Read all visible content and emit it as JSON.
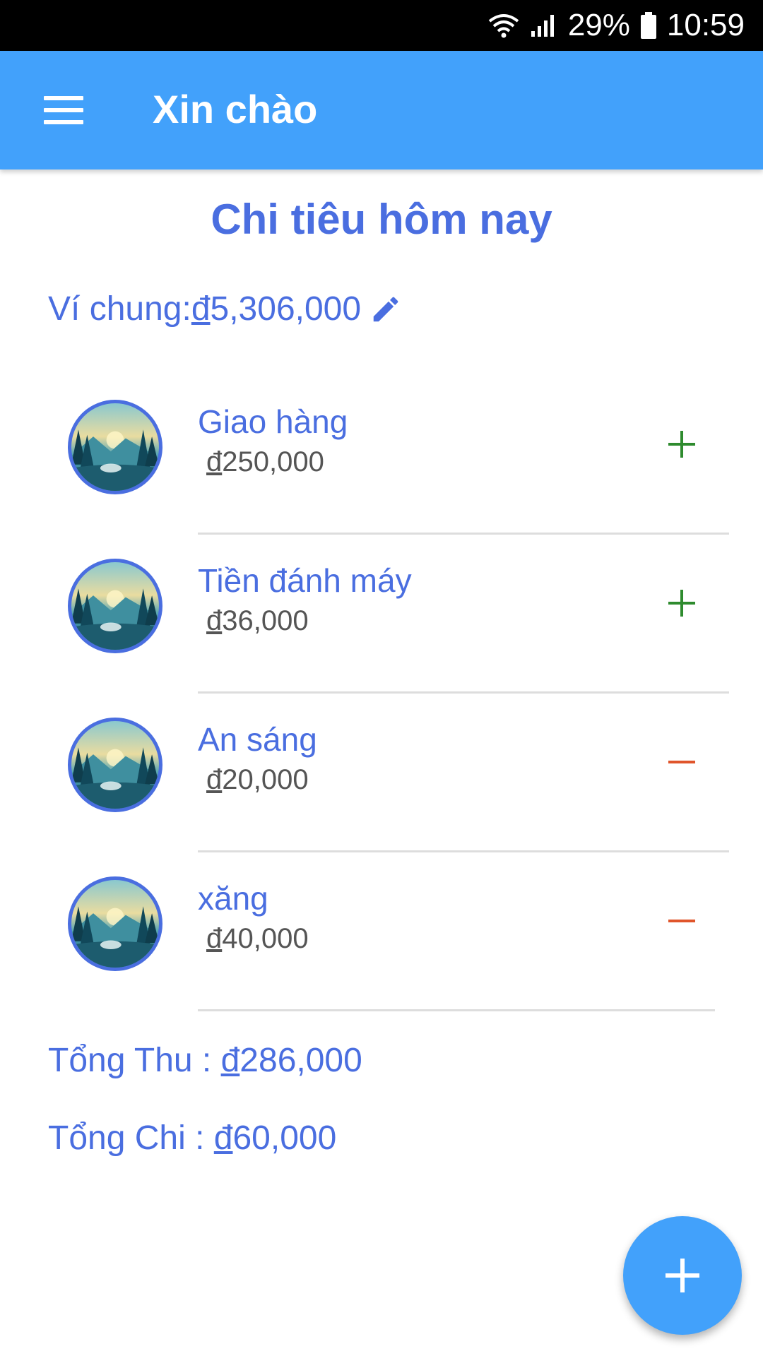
{
  "status_bar": {
    "battery": "29%",
    "time": "10:59",
    "icons": [
      "wifi-icon",
      "signal-icon",
      "battery-icon"
    ]
  },
  "app_bar": {
    "title": "Xin chào",
    "menu_icon": "menu-icon",
    "color": "#42a1fb"
  },
  "page": {
    "title": "Chi tiêu hôm nay",
    "wallet_label": "Ví chung: ",
    "wallet_currency": "đ",
    "wallet_amount": "5,306,000",
    "edit_icon": "pencil-icon"
  },
  "transactions": [
    {
      "name": "Giao hàng",
      "currency": "đ",
      "amount": "250,000",
      "type": "income",
      "action_icon": "plus-icon"
    },
    {
      "name": "Tiền đánh máy",
      "currency": "đ",
      "amount": "36,000",
      "type": "income",
      "action_icon": "plus-icon"
    },
    {
      "name": "An sáng",
      "currency": "đ",
      "amount": "20,000",
      "type": "expense",
      "action_icon": "minus-icon"
    },
    {
      "name": "xăng",
      "currency": "đ",
      "amount": "40,000",
      "type": "expense",
      "action_icon": "minus-icon"
    }
  ],
  "totals": {
    "income_label": "Tổng Thu : ",
    "income_currency": "đ",
    "income_amount": "286,000",
    "expense_label": "Tổng Chi : ",
    "expense_currency": "đ",
    "expense_amount": "60,000"
  },
  "fab": {
    "icon": "plus-icon"
  },
  "colors": {
    "accent": "#4a6ee0",
    "income": "#2e8b2e",
    "expense": "#e0552b",
    "app_bar": "#42a1fb"
  }
}
